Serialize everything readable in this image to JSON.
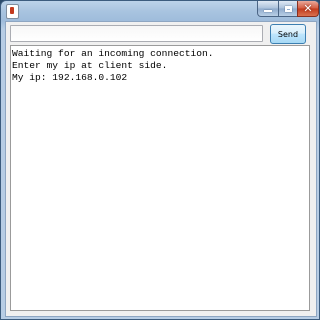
{
  "window": {
    "title": "",
    "controls": {
      "minimize": "minimize",
      "maximize": "maximize",
      "close": "✕"
    }
  },
  "message_input": {
    "value": "",
    "placeholder": ""
  },
  "send_button": {
    "label": "Send"
  },
  "log": {
    "lines": [
      "Waiting for an incoming connection.",
      "Enter my ip at client side.",
      "My ip: 192.168.0.102"
    ]
  }
}
